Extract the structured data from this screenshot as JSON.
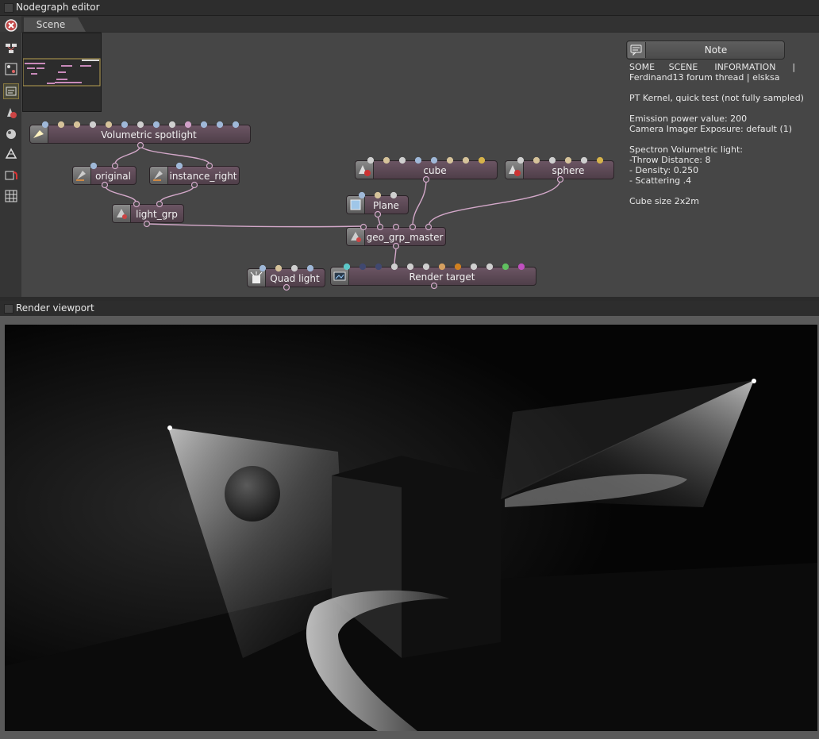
{
  "nodegraph": {
    "title": "Nodegraph editor",
    "tab": "Scene",
    "note": {
      "label": "Note",
      "text": "SOME     SCENE      INFORMATION      |\nFerdinand13 forum thread | elsksa\n\nPT Kernel, quick test (not fully sampled)\n\nEmission power value: 200\nCamera Imager Exposure: default (1)\n\nSpectron Volumetric light:\n-Throw Distance: 8\n- Density: 0.250\n- Scattering .4\n\nCube size 2x2m"
    },
    "nodes": {
      "volumetric_spotlight": "Volumetric spotlight",
      "original": "original",
      "instance_right": "instance_right",
      "light_grp": "light_grp",
      "cube": "cube",
      "sphere": "sphere",
      "plane": "Plane",
      "geo_grp_master": "geo_grp_master",
      "quad_light": "Quad light",
      "render_target": "Render target"
    },
    "toolbar_icons": [
      "node-graph-reset-icon",
      "node-layout-icon",
      "node-group-icon",
      "scene-graph-icon",
      "material-icon",
      "texture-icon",
      "mesh-icon",
      "camera-icon",
      "grid-icon"
    ]
  },
  "viewport": {
    "title": "Render viewport"
  },
  "colors": {
    "node_fill": "#5e4a57",
    "wire": "#d3a8c9",
    "panel": "#464646"
  }
}
